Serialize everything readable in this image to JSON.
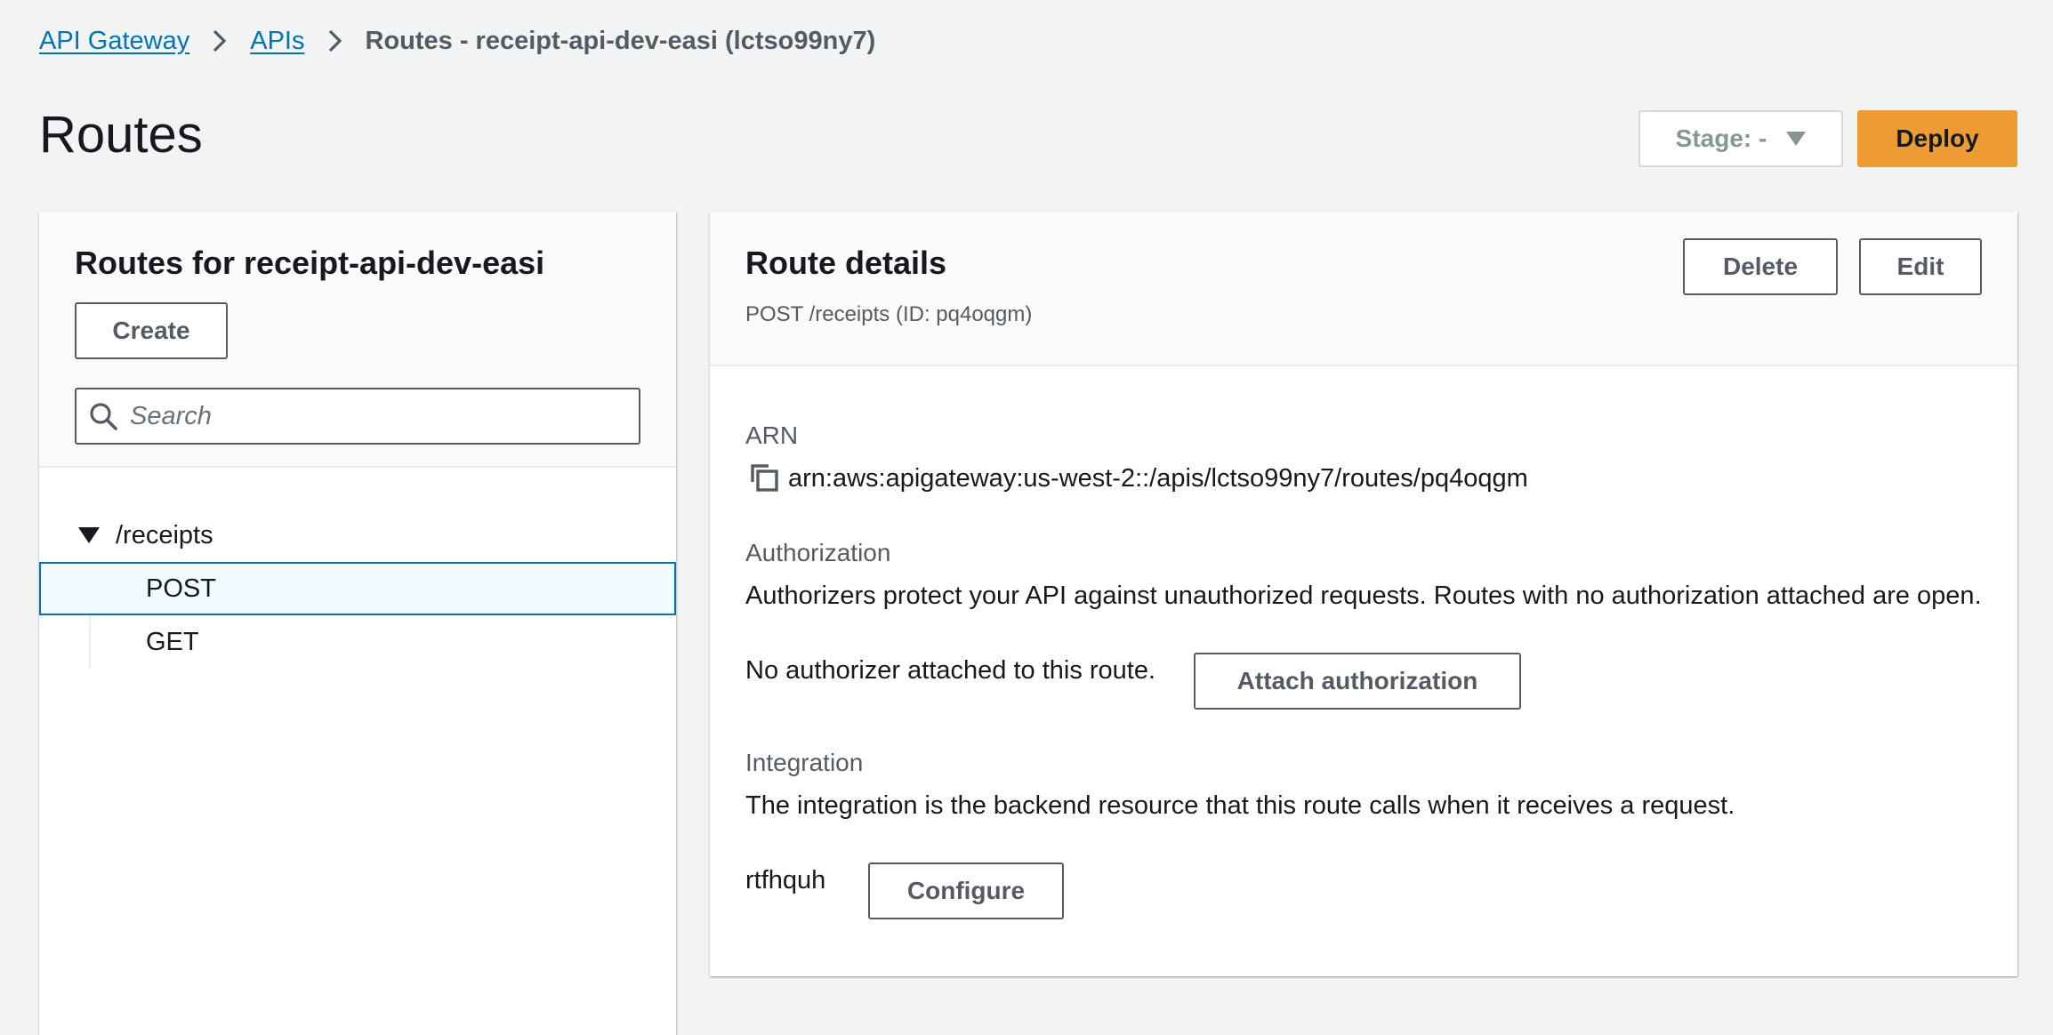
{
  "breadcrumb": {
    "items": [
      "API Gateway",
      "APIs"
    ],
    "current": "Routes - receipt-api-dev-easi (lctso99ny7)"
  },
  "header": {
    "title": "Routes",
    "stage_label": "Stage: -",
    "deploy_label": "Deploy"
  },
  "routes_panel": {
    "title": "Routes for receipt-api-dev-easi",
    "create_label": "Create",
    "search_placeholder": "Search",
    "search_value": "",
    "groups": [
      {
        "path": "/receipts",
        "methods": [
          "POST",
          "GET"
        ],
        "selected": "POST"
      }
    ]
  },
  "details": {
    "title": "Route details",
    "subtitle": "POST /receipts (ID: pq4oqgm)",
    "delete_label": "Delete",
    "edit_label": "Edit",
    "arn_label": "ARN",
    "arn_value": "arn:aws:apigateway:us-west-2::/apis/lctso99ny7/routes/pq4oqgm",
    "auth_label": "Authorization",
    "auth_description": "Authorizers protect your API against unauthorized requests. Routes with no authorization attached are open.",
    "auth_status": "No authorizer attached to this route.",
    "attach_label": "Attach authorization",
    "integration_label": "Integration",
    "integration_description": "The integration is the backend resource that this route calls when it receives a request.",
    "integration_id": "rtfhquh",
    "configure_label": "Configure"
  },
  "colors": {
    "link": "#0073bb",
    "primary_button": "#ec9c33",
    "background": "#f2f3f3",
    "selected_border": "#0073bb"
  },
  "icons": [
    "chevron-right-icon",
    "caret-down-icon",
    "search-icon",
    "copy-icon"
  ]
}
